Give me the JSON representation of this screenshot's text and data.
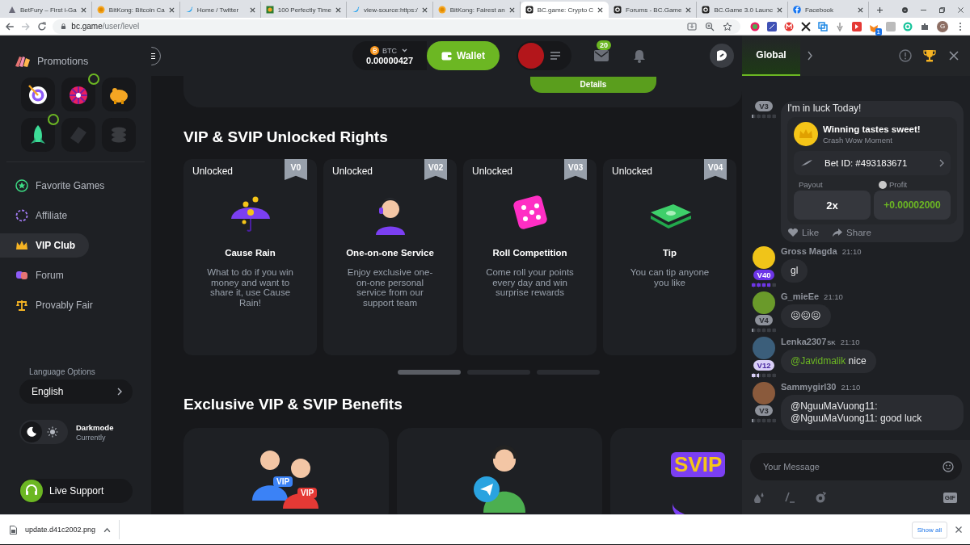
{
  "browser": {
    "tabs": [
      {
        "title": "BetFury – First i-Ga",
        "kind": "betfury",
        "selected": false
      },
      {
        "title": "BitKong: Bitcoin Ca",
        "kind": "bitkong",
        "selected": false
      },
      {
        "title": "Home / Twitter",
        "kind": "twitter",
        "selected": false
      },
      {
        "title": "100 Perfectly Time",
        "kind": "image",
        "selected": false
      },
      {
        "title": "view-source:https:/",
        "kind": "twitter",
        "selected": false
      },
      {
        "title": "BitKong: Fairest an",
        "kind": "bitkong",
        "selected": false
      },
      {
        "title": "BC.game: Crypto C",
        "kind": "bcgame",
        "selected": true
      },
      {
        "title": "Forums - BC.Game",
        "kind": "bcgame",
        "selected": false
      },
      {
        "title": "BC.Game 3.0 Launc",
        "kind": "bcgame",
        "selected": false
      },
      {
        "title": "Facebook",
        "kind": "facebook",
        "selected": false
      }
    ],
    "url": {
      "host": "bc.game",
      "path": "/user/level"
    },
    "profile": "G",
    "extension_badge": "1"
  },
  "header": {
    "balance": {
      "currency": "BTC",
      "amount": "0.00000427"
    },
    "wallet": "Wallet",
    "mail_count": "20"
  },
  "sidebar": {
    "promotions": "Promotions",
    "promo_tiles": [
      {
        "kind": "target",
        "ring": false
      },
      {
        "kind": "wheel",
        "ring": true
      },
      {
        "kind": "piggy",
        "ring": false
      },
      {
        "kind": "rocket",
        "ring": true
      },
      {
        "kind": "ticket",
        "ring": false
      },
      {
        "kind": "coins",
        "ring": false
      }
    ],
    "nav": [
      {
        "label": "Favorite Games",
        "kind": "star",
        "selected": false
      },
      {
        "label": "Affiliate",
        "kind": "affiliate",
        "selected": false
      },
      {
        "label": "VIP Club",
        "kind": "crown",
        "selected": true
      },
      {
        "label": "Forum",
        "kind": "forum",
        "selected": false
      },
      {
        "label": "Provably Fair",
        "kind": "fair",
        "selected": false
      }
    ],
    "language": {
      "label": "Language Options",
      "value": "English"
    },
    "theme": {
      "title": "Darkmode",
      "subtitle": "Currently",
      "dark": true
    },
    "support": "Live Support"
  },
  "main": {
    "top_button": "Details",
    "rights": {
      "title": "VIP & SVIP Unlocked Rights",
      "cards": [
        {
          "status": "Unlocked",
          "level": "V0",
          "kind": "rain",
          "title": "Cause Rain",
          "text": "What to do if you win money and want to share it, use Cause Rain!"
        },
        {
          "status": "Unlocked",
          "level": "V02",
          "kind": "service",
          "title": "One-on-one Service",
          "text": "Enjoy exclusive one-on-one personal service from our support team"
        },
        {
          "status": "Unlocked",
          "level": "V03",
          "kind": "dice",
          "title": "Roll Competition",
          "text": "Come roll your points every day and win surprise rewards"
        },
        {
          "status": "Unlocked",
          "level": "V04",
          "kind": "tip",
          "title": "Tip",
          "text": "You can tip anyone you like"
        }
      ]
    },
    "pager": [
      {
        "selected": true
      },
      {
        "selected": false
      },
      {
        "selected": false
      }
    ],
    "benefits": {
      "title": "Exclusive VIP & SVIP Benefits",
      "cards": [
        {
          "kind": "vip",
          "badges": [
            "VIP",
            "VIP"
          ]
        },
        {
          "kind": "support"
        },
        {
          "kind": "svip",
          "badges": [
            "SVIP"
          ]
        }
      ]
    }
  },
  "chat": {
    "tab": {
      "label": "Global",
      "selected": true
    },
    "messages": [
      {
        "kind": "share",
        "badge": {
          "label": "V3",
          "color": "#8e929b",
          "level": 0.1
        },
        "text": "I'm in luck Today!",
        "card": {
          "title": "Winning tastes sweet!",
          "subtitle": "Crash Wow Moment",
          "bet": "Bet ID: #493183671",
          "payout_label": "Payout",
          "payout": "2x",
          "profit_label": "Profit",
          "profit": "+0.00002000",
          "like": "Like",
          "share": "Share"
        }
      },
      {
        "kind": "text",
        "name": "Gross Magda",
        "time": "21:10",
        "avatar": {
          "color": "#f0c419"
        },
        "badge": {
          "label": "V40",
          "color": "#6d35e8",
          "level": 0.75
        },
        "text": "gl"
      },
      {
        "kind": "text",
        "name": "G_mieEe",
        "time": "21:10",
        "avatar": {
          "color": "#6a9a2a"
        },
        "badge": {
          "label": "V4",
          "color": "#8e929b",
          "level": 0.1
        },
        "text": "😖😖😖"
      },
      {
        "kind": "text",
        "name": "Lenka2307",
        "suffix": "SK",
        "time": "21:10",
        "avatar": {
          "color": "#3b5e7a"
        },
        "badge": {
          "label": "V12",
          "color": "#d9cff7",
          "level": 0.3
        },
        "mention": "@Javidmalik",
        "text": "nice"
      },
      {
        "kind": "text",
        "name": "Sammygirl30",
        "time": "21:10",
        "avatar": {
          "color": "#8a5a3c"
        },
        "badge": {
          "label": "V3",
          "color": "#8e929b",
          "level": 0.1
        },
        "text": "@NguuMaVuong11: @NguuMaVuong11: good luck"
      }
    ],
    "input": {
      "placeholder": "Your Message"
    },
    "gif": "GIF"
  },
  "downloads": {
    "file": "update.d41c2002.png",
    "show_all": "Show all"
  }
}
